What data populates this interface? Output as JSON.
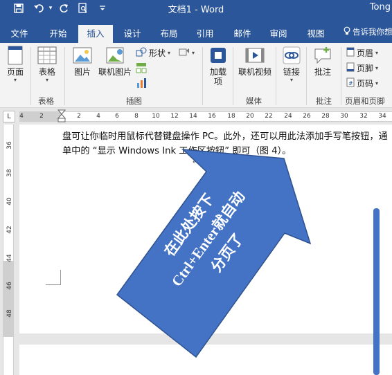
{
  "titlebar": {
    "save_icon": "save-icon",
    "undo_icon": "undo-icon",
    "redo_icon": "redo-icon",
    "preview_icon": "print-preview-icon",
    "customize_icon": "customize-qat-icon",
    "title": "文档1 - Word",
    "user": "Tong"
  },
  "tabs": [
    {
      "label": "文件"
    },
    {
      "label": "开始"
    },
    {
      "label": "插入"
    },
    {
      "label": "设计"
    },
    {
      "label": "布局"
    },
    {
      "label": "引用"
    },
    {
      "label": "邮件"
    },
    {
      "label": "审阅"
    },
    {
      "label": "视图"
    }
  ],
  "active_tab": "插入",
  "tell_me": "告诉我你想",
  "ribbon": {
    "page": {
      "label": "页面"
    },
    "table": {
      "label": "表格"
    },
    "picture": {
      "label": "图片"
    },
    "online_picture": {
      "label": "联机图片"
    },
    "shapes": {
      "label": "形状"
    },
    "addins": {
      "label_line1": "加载",
      "label_line2": "项"
    },
    "online_video": {
      "label": "联机视频"
    },
    "link": {
      "label": "链接"
    },
    "comment": {
      "label": "批注"
    },
    "header": {
      "label": "页眉"
    },
    "footer": {
      "label": "页脚"
    },
    "page_number": {
      "label": "页码"
    },
    "groups": {
      "table": "表格",
      "illustrations": "插图",
      "media": "媒体",
      "comments": "批注",
      "header_footer": "页眉和页脚"
    }
  },
  "ruler": {
    "corner": "L",
    "numbers": [
      "4",
      "2",
      "2",
      "4",
      "6",
      "8",
      "10",
      "12",
      "14",
      "16",
      "18",
      "20",
      "22",
      "24",
      "26",
      "28",
      "30",
      "32",
      "34"
    ],
    "vertical_numbers": [
      "36",
      "38",
      "40",
      "42",
      "44",
      "46",
      "48"
    ]
  },
  "document": {
    "line1": "盘可让你临时用鼠标代替键盘操作 PC。此外，还可以用此法添加手写笔按钮，通",
    "line2": "单中的 “显示 Windows Ink 工作区按钮” 即可（图 4）。",
    "para_mark": "↵"
  },
  "callout": {
    "line1": "在此处按下",
    "line2": "Ctrl+Enter就自动",
    "line3": "分页了"
  },
  "colors": {
    "brand": "#2b579a",
    "arrow_fill": "#4472c4",
    "arrow_stroke": "#2f528f"
  }
}
